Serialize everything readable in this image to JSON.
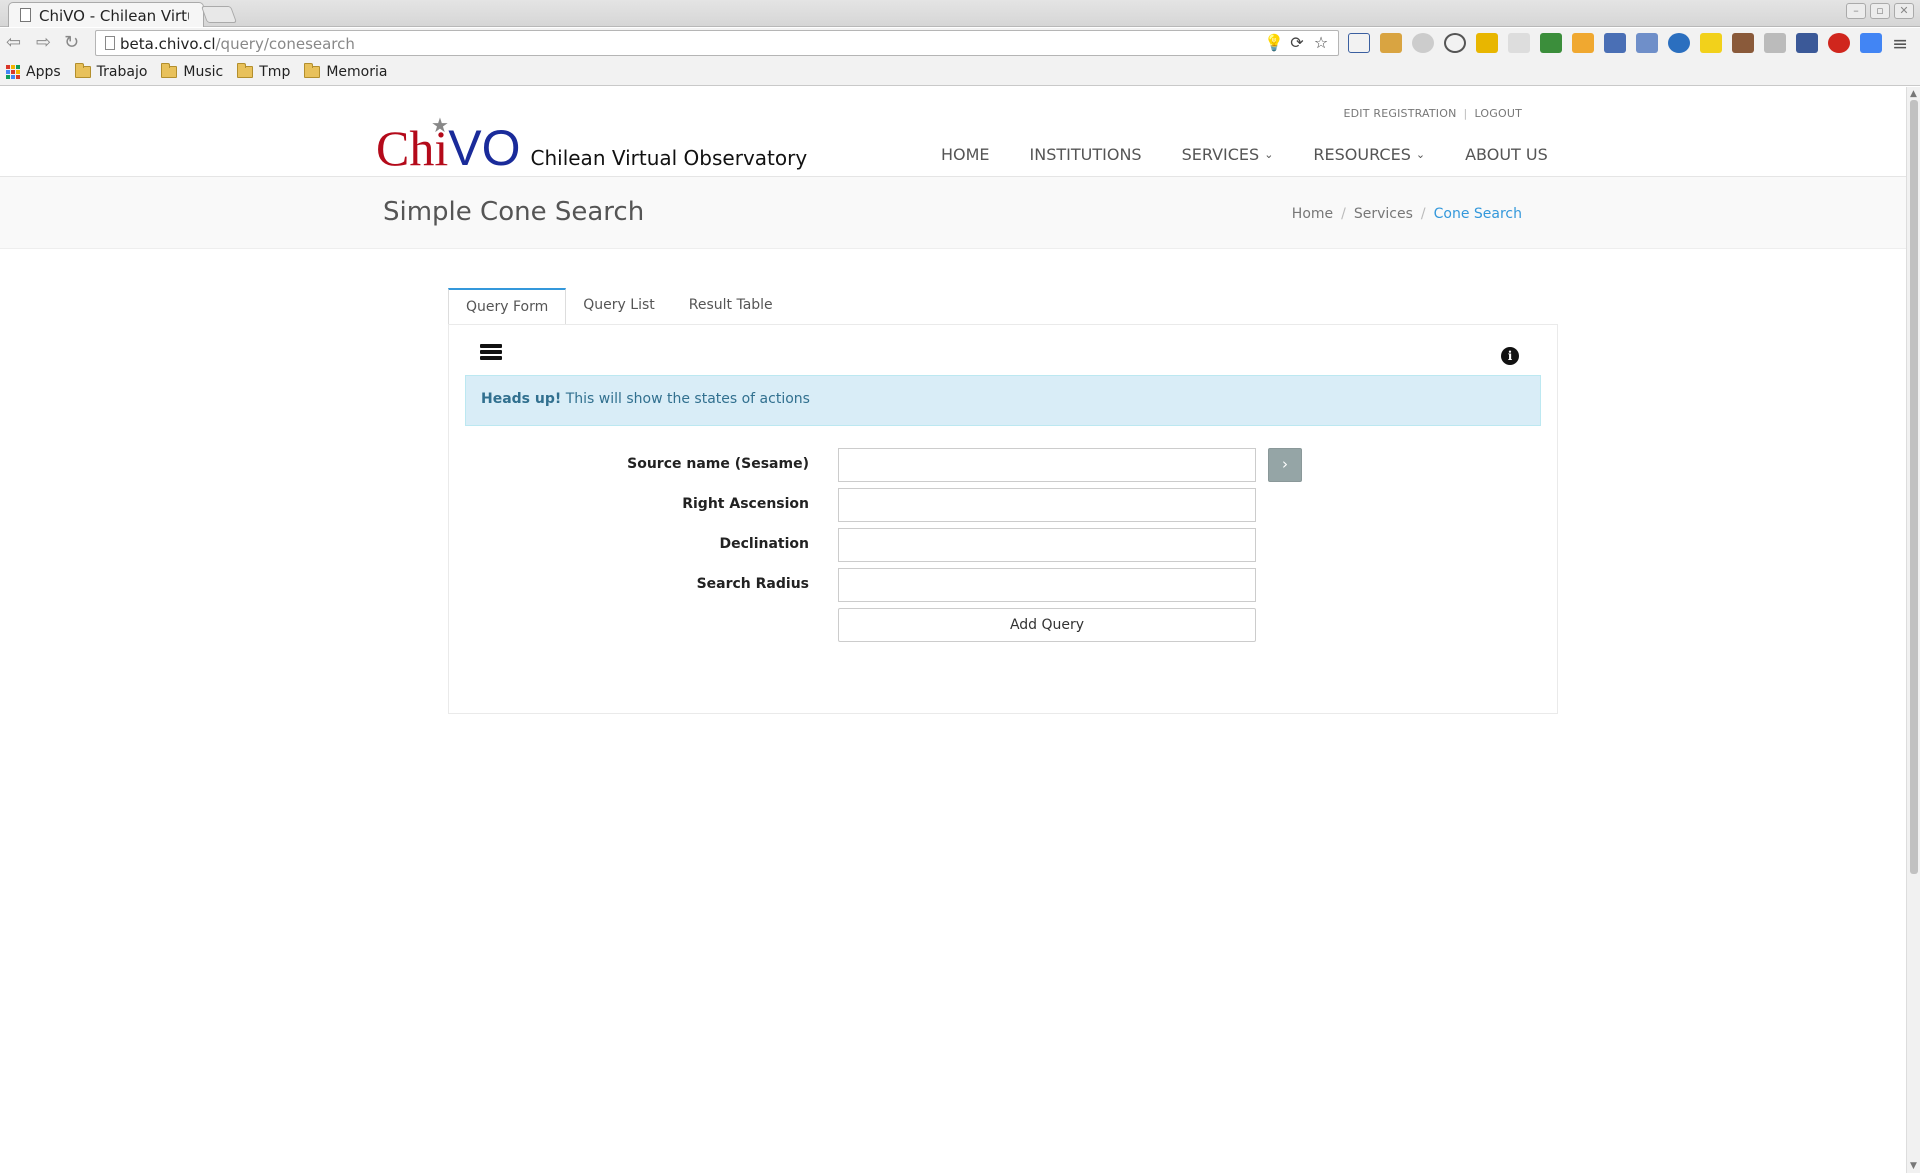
{
  "browser": {
    "tab_title": "ChiVO - Chilean Virtual Observatory",
    "url_host": "beta.chivo.cl",
    "url_path": "/query/conesearch",
    "bookmarks": [
      {
        "label": "Apps",
        "icon": "apps-grid-icon"
      },
      {
        "label": "Trabajo",
        "icon": "folder-icon"
      },
      {
        "label": "Music",
        "icon": "folder-icon"
      },
      {
        "label": "Tmp",
        "icon": "folder-icon"
      },
      {
        "label": "Memoria",
        "icon": "folder-icon"
      }
    ]
  },
  "header": {
    "logo_chi": "Chi",
    "logo_vo": "VO",
    "tagline": "Chilean Virtual Observatory",
    "top_links": {
      "edit_registration": "EDIT REGISTRATION",
      "logout": "LOGOUT"
    },
    "nav": {
      "home": "HOME",
      "institutions": "INSTITUTIONS",
      "services": "SERVICES",
      "resources": "RESOURCES",
      "about": "ABOUT US"
    }
  },
  "titlebar": {
    "title": "Simple Cone Search",
    "breadcrumb": {
      "home": "Home",
      "services": "Services",
      "current": "Cone Search"
    }
  },
  "tabs": {
    "query_form": "Query Form",
    "query_list": "Query List",
    "result_table": "Result Table"
  },
  "alert": {
    "strong": "Heads up!",
    "text": "This will show the states of actions"
  },
  "form": {
    "source_name": {
      "label": "Source name (Sesame)",
      "value": ""
    },
    "right_ascension": {
      "label": "Right Ascension",
      "value": ""
    },
    "declination": {
      "label": "Declination",
      "value": ""
    },
    "search_radius": {
      "label": "Search Radius",
      "value": ""
    },
    "resolve_button": "›",
    "add_query": "Add Query"
  },
  "colors": {
    "accent": "#3498db",
    "logo_red": "#b40a1a",
    "logo_blue": "#1a2b9a",
    "alert_bg": "#d9edf7"
  }
}
